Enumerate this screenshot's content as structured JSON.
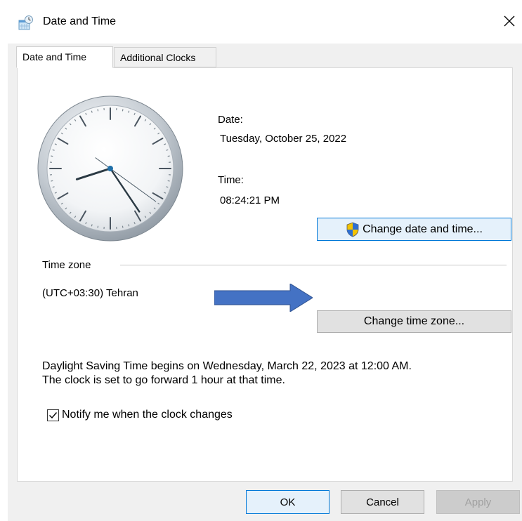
{
  "window": {
    "title": "Date and Time",
    "close_glyph": "✕",
    "icon": "date-time-app-icon"
  },
  "tabs": [
    {
      "label": "Date and Time",
      "active": true
    },
    {
      "label": "Additional Clocks",
      "active": false
    }
  ],
  "datetime": {
    "date_label": "Date:",
    "date_value": "Tuesday, October 25, 2022",
    "time_label": "Time:",
    "time_value": "08:24:21 PM",
    "change_button": "Change date and time...",
    "change_button_icon": "uac-shield-icon"
  },
  "clock": {
    "hours": 8,
    "minutes": 24,
    "seconds": 21
  },
  "annotation": {
    "icon": "blue-arrow-right-icon",
    "color": "#4472c4"
  },
  "timezone": {
    "group_label": "Time zone",
    "value": "(UTC+03:30) Tehran",
    "change_button": "Change time zone..."
  },
  "dst": {
    "line1": "Daylight Saving Time begins on Wednesday, March 22, 2023 at 12:00 AM.",
    "line2": "The clock is set to go forward 1 hour at that time.",
    "notify_label": "Notify me when the clock changes",
    "notify_checked": true
  },
  "footer": {
    "ok": "OK",
    "cancel": "Cancel",
    "apply": "Apply"
  },
  "colors": {
    "focus_border": "#0078d7",
    "window_bg": "#f0f0f0",
    "panel_bg": "#ffffff"
  }
}
